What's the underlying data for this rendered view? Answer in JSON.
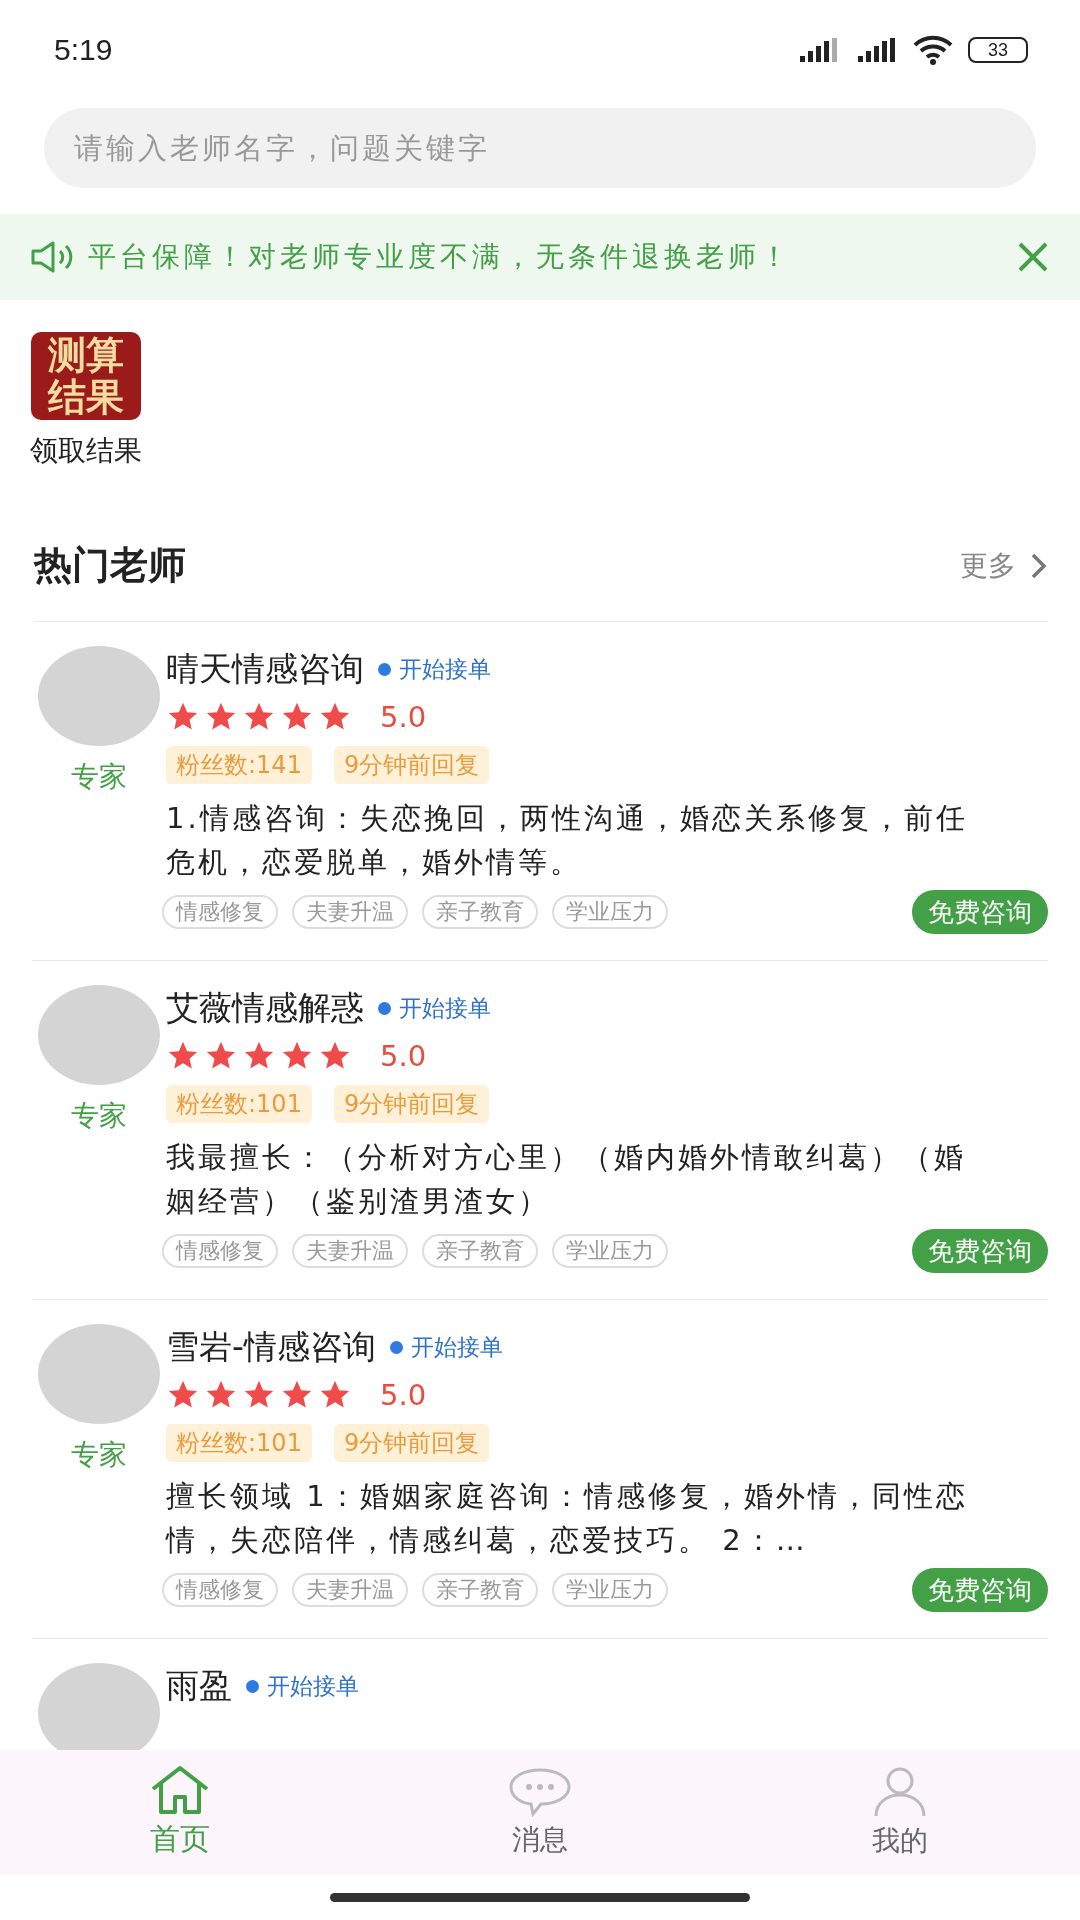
{
  "status_bar": {
    "time": "5:19",
    "battery": "33"
  },
  "search": {
    "placeholder": "请输入老师名字，问题关键字"
  },
  "notice": {
    "text": "平台保障！对老师专业度不满，无条件退换老师！"
  },
  "shortcuts": [
    {
      "icon_text": "测算结果",
      "label": "领取结果"
    }
  ],
  "section": {
    "title": "热门老师",
    "more": "更多"
  },
  "teachers": [
    {
      "name": "晴天情感咨询",
      "status": "开始接单",
      "stars": 5,
      "rating": "5.0",
      "title": "专家",
      "fans": "粉丝数:141",
      "reply": "9分钟前回复",
      "desc": "1.情感咨询：失恋挽回，两性沟通，婚恋关系修复，前任危机，恋爱脱单，婚外情等。",
      "tags": [
        "情感修复",
        "夫妻升温",
        "亲子教育",
        "学业压力"
      ],
      "button": "免费咨询"
    },
    {
      "name": "艾薇情感解惑",
      "status": "开始接单",
      "stars": 5,
      "rating": "5.0",
      "title": "专家",
      "fans": "粉丝数:101",
      "reply": "9分钟前回复",
      "desc": "我最擅长：（分析对方心里）（婚内婚外情敢纠葛）（婚姻经营）（鉴别渣男渣女）",
      "tags": [
        "情感修复",
        "夫妻升温",
        "亲子教育",
        "学业压力"
      ],
      "button": "免费咨询"
    },
    {
      "name": "雪岩-情感咨询",
      "status": "开始接单",
      "stars": 5,
      "rating": "5.0",
      "title": "专家",
      "fans": "粉丝数:101",
      "reply": "9分钟前回复",
      "desc": "擅长领域 1：婚姻家庭咨询：情感修复，婚外情，同性恋情，失恋陪伴，情感纠葛，恋爱技巧。 2：…",
      "tags": [
        "情感修复",
        "夫妻升温",
        "亲子教育",
        "学业压力"
      ],
      "button": "免费咨询"
    },
    {
      "name": "雨盈",
      "status": "开始接单"
    }
  ],
  "tab_bar": [
    {
      "label": "首页",
      "kind": "home",
      "selected": true
    },
    {
      "label": "消息",
      "kind": "message",
      "selected": false
    },
    {
      "label": "我的",
      "kind": "profile",
      "selected": false
    }
  ]
}
